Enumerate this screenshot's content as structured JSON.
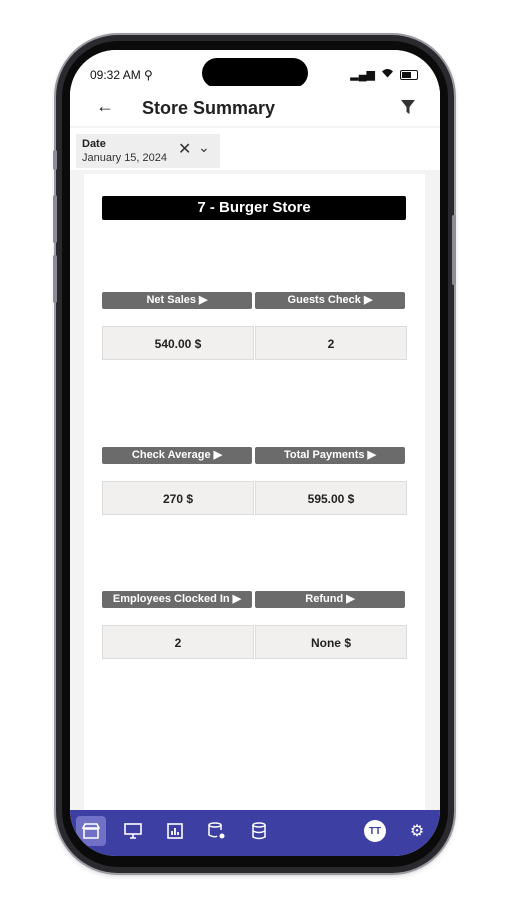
{
  "status_bar": {
    "time": "09:32 AM ⚲"
  },
  "header": {
    "title": "Store Summary",
    "back_icon": "arrow-left",
    "filter_icon": "filter-funnel"
  },
  "date_filter": {
    "label": "Date",
    "value": "January 15, 2024"
  },
  "store": {
    "title": "7 - Burger Store"
  },
  "metrics": [
    {
      "label": "Net Sales ▶",
      "value": "540.00 $"
    },
    {
      "label": "Guests Check ▶",
      "value": "2"
    },
    {
      "label": "Check Average ▶",
      "value": "270 $"
    },
    {
      "label": "Total Payments ▶",
      "value": "595.00 $"
    },
    {
      "label": "Employees Clocked In ▶",
      "value": "2"
    },
    {
      "label": "Refund ▶",
      "value": "None $"
    }
  ],
  "bottom_nav": {
    "avatar_initials": "TT",
    "items": [
      "store-icon",
      "monitor-icon",
      "chart-icon",
      "database-gear-icon",
      "database-icon",
      "avatar",
      "settings-icon"
    ]
  },
  "colors": {
    "nav_bg": "#3e3fa3",
    "card_header": "#6b6b6b",
    "title_bar": "#000000"
  }
}
